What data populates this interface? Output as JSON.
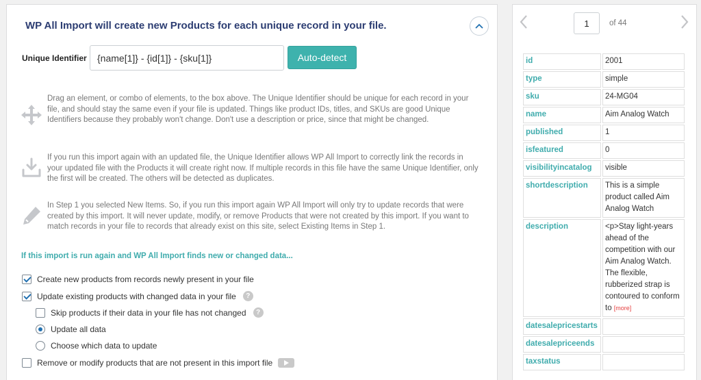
{
  "panel": {
    "title": "WP All Import will create new Products for each unique record in your file.",
    "unique_identifier_label": "Unique Identifier",
    "unique_identifier_value": "{name[1]} - {id[1]} - {sku[1]}",
    "auto_detect_label": "Auto-detect"
  },
  "info": [
    {
      "icon": "move-arrows-icon",
      "text": "Drag an element, or combo of elements, to the box above. The Unique Identifier should be unique for each record in your file, and should stay the same even if your file is updated. Things like product IDs, titles, and SKUs are good Unique Identifiers because they probably won't change. Don't use a description or price, since that might be changed."
    },
    {
      "icon": "download-tray-icon",
      "text": "If you run this import again with an updated file, the Unique Identifier allows WP All Import to correctly link the records in your updated file with the Products it will create right now. If multiple records in this file have the same Unique Identifier, only the first will be created. The others will be detected as duplicates."
    },
    {
      "icon": "pencil-icon",
      "text": "In Step 1 you selected New Items. So, if you run this import again WP All Import will only try to update records that were created by this import. It will never update, modify, or remove Products that were not created by this import. If you want to match records in your file to records that already exist on this site, select Existing Items in Step 1."
    }
  ],
  "section_heading": "If this import is run again and WP All Import finds new or changed data...",
  "options": {
    "create_new": "Create new products from records newly present in your file",
    "update_existing": "Update existing products with changed data in your file",
    "skip_unchanged": "Skip products if their data in your file has not changed",
    "update_all": "Update all data",
    "choose_data": "Choose which data to update",
    "remove_missing": "Remove or modify products that are not present in this import file",
    "help_glyph": "?"
  },
  "preview": {
    "current_page": "1",
    "of_label": "of 44",
    "more_label": "[more]",
    "rows": [
      {
        "key": "id",
        "value": "2001"
      },
      {
        "key": "type",
        "value": "simple"
      },
      {
        "key": "sku",
        "value": "24-MG04"
      },
      {
        "key": "name",
        "value": "Aim Analog Watch"
      },
      {
        "key": "published",
        "value": "1"
      },
      {
        "key": "isfeatured",
        "value": "0"
      },
      {
        "key": "visibilityincatalog",
        "value": "visible"
      },
      {
        "key": "shortdescription",
        "value": "This is a simple product called Aim Analog Watch"
      },
      {
        "key": "description",
        "value": "<p>Stay light-years ahead of the competition with our Aim Analog Watch. The flexible, rubberized strap is contoured to conform to"
      },
      {
        "key": "datesalepricestarts",
        "value": ""
      },
      {
        "key": "datesalepriceends",
        "value": ""
      },
      {
        "key": "taxstatus",
        "value": ""
      }
    ]
  },
  "colors": {
    "accent": "#3eb2ad",
    "title": "#2c3d72",
    "key": "#40acad",
    "check": "#2271b1"
  }
}
